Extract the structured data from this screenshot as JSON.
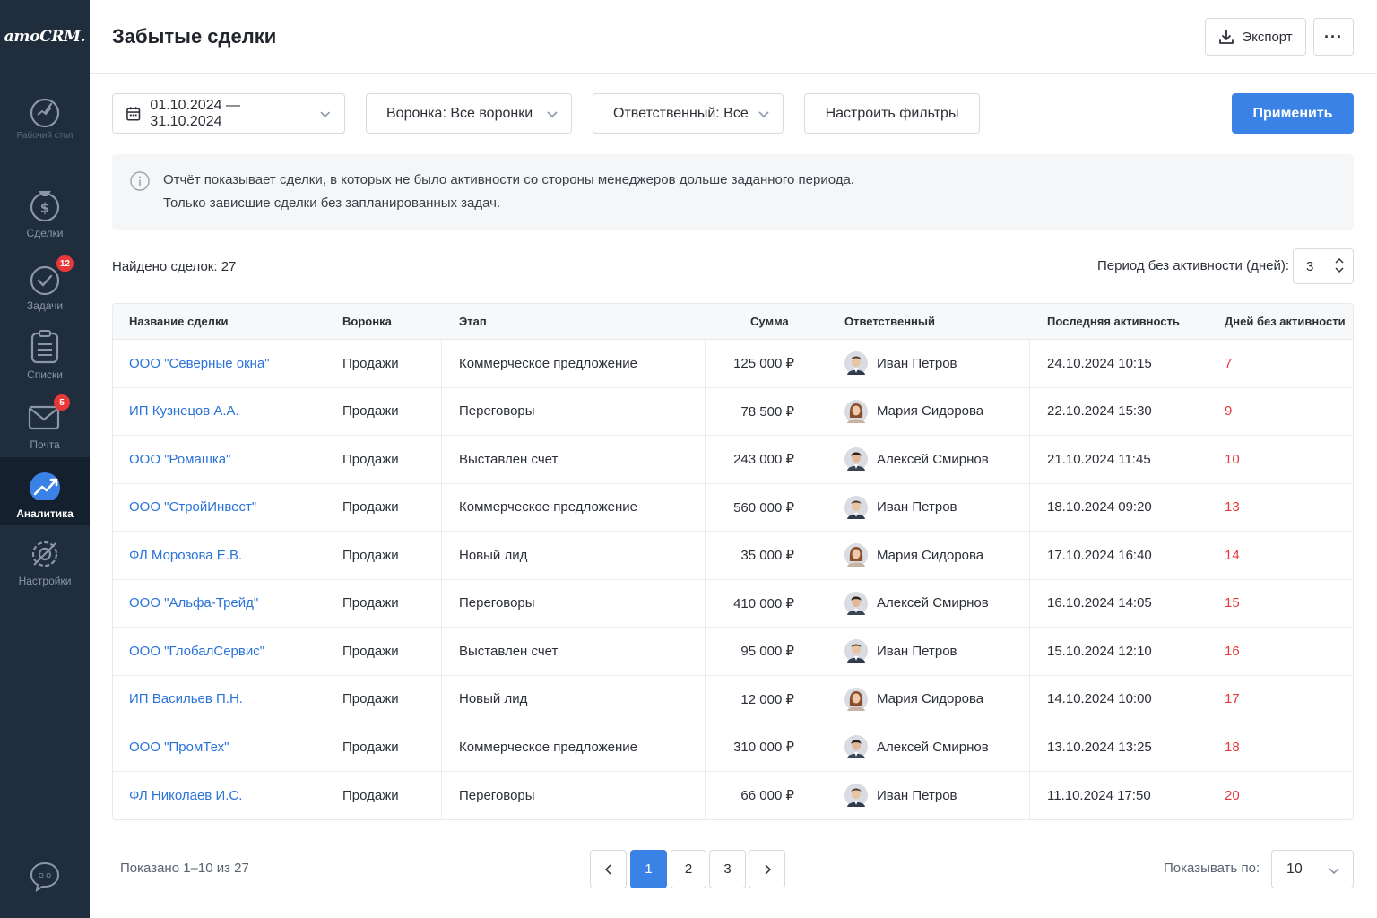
{
  "app": {
    "logo": "amoCRM."
  },
  "sidebar": {
    "items": [
      {
        "label": "",
        "sublabel": "Рабочий стол",
        "icon": "dashboard-icon"
      },
      {
        "label": "Сделки",
        "icon": "deals-icon"
      },
      {
        "label": "Задачи",
        "icon": "tasks-icon",
        "badge": "12"
      },
      {
        "label": "Списки",
        "icon": "lists-icon"
      },
      {
        "label": "Почта",
        "icon": "mail-icon",
        "badge": "5"
      },
      {
        "label": "Аналитика",
        "icon": "analytics-icon",
        "active": true
      },
      {
        "label": "Настройки",
        "icon": "settings-icon"
      }
    ],
    "chat_icon": "chat-icon"
  },
  "header": {
    "title": "Забытые сделки",
    "export_label": "Экспорт",
    "more_label": "···"
  },
  "filters": {
    "date_range": "01.10.2024 — 31.10.2024",
    "pipeline": "Воронка: Все воронки",
    "responsible": "Ответственный: Все",
    "configure": "Настроить фильтры",
    "apply": "Применить"
  },
  "info": {
    "line1": "Отчёт показывает сделки, в которых не было активности со стороны менеджеров дольше заданного периода.",
    "line2": "Только зависшие сделки без запланированных задач."
  },
  "summary": {
    "found": "Найдено сделок: 27",
    "period_label": "Период без активности (дней):",
    "period_value": "3"
  },
  "table": {
    "columns": [
      "Название сделки",
      "Воронка",
      "Этап",
      "Сумма",
      "Ответственный",
      "Последняя активность",
      "Дней без активности"
    ],
    "rows": [
      {
        "name": "ООО \"Северные окна\"",
        "pipeline": "Продажи",
        "stage": "Коммерческое предложение",
        "sum": "125 000 ₽",
        "owner": "Иван Петров",
        "avatar": "m1",
        "last": "24.10.2024 10:15",
        "days": "7"
      },
      {
        "name": "ИП Кузнецов А.А.",
        "pipeline": "Продажи",
        "stage": "Переговоры",
        "sum": "78 500 ₽",
        "owner": "Мария Сидорова",
        "avatar": "f",
        "last": "22.10.2024 15:30",
        "days": "9"
      },
      {
        "name": "ООО \"Ромашка\"",
        "pipeline": "Продажи",
        "stage": "Выставлен счет",
        "sum": "243 000 ₽",
        "owner": "Алексей Смирнов",
        "avatar": "m2",
        "last": "21.10.2024 11:45",
        "days": "10"
      },
      {
        "name": "ООО \"СтройИнвест\"",
        "pipeline": "Продажи",
        "stage": "Коммерческое предложение",
        "sum": "560 000 ₽",
        "owner": "Иван Петров",
        "avatar": "m1",
        "last": "18.10.2024 09:20",
        "days": "13"
      },
      {
        "name": "ФЛ Морозова Е.В.",
        "pipeline": "Продажи",
        "stage": "Новый лид",
        "sum": "35 000 ₽",
        "owner": "Мария Сидорова",
        "avatar": "f",
        "last": "17.10.2024 16:40",
        "days": "14"
      },
      {
        "name": "ООО \"Альфа-Трейд\"",
        "pipeline": "Продажи",
        "stage": "Переговоры",
        "sum": "410 000 ₽",
        "owner": "Алексей Смирнов",
        "avatar": "m2",
        "last": "16.10.2024 14:05",
        "days": "15"
      },
      {
        "name": "ООО \"ГлобалСервис\"",
        "pipeline": "Продажи",
        "stage": "Выставлен счет",
        "sum": "95 000 ₽",
        "owner": "Иван Петров",
        "avatar": "m1",
        "last": "15.10.2024 12:10",
        "days": "16"
      },
      {
        "name": "ИП Васильев П.Н.",
        "pipeline": "Продажи",
        "stage": "Новый лид",
        "sum": "12 000 ₽",
        "owner": "Мария Сидорова",
        "avatar": "f",
        "last": "14.10.2024 10:00",
        "days": "17"
      },
      {
        "name": "ООО \"ПромТех\"",
        "pipeline": "Продажи",
        "stage": "Коммерческое предложение",
        "sum": "310 000 ₽",
        "owner": "Алексей Смирнов",
        "avatar": "m2",
        "last": "13.10.2024 13:25",
        "days": "18"
      },
      {
        "name": "ФЛ Николаев И.С.",
        "pipeline": "Продажи",
        "stage": "Переговоры",
        "sum": "66 000 ₽",
        "owner": "Иван Петров",
        "avatar": "m1",
        "last": "11.10.2024 17:50",
        "days": "20"
      }
    ]
  },
  "pagination": {
    "shown": "Показано 1–10 из 27",
    "pages": [
      "1",
      "2",
      "3"
    ],
    "current": "1",
    "per_page_label": "Показывать по:",
    "per_page_value": "10"
  },
  "colors": {
    "sidebar": "#1f2d3d",
    "accent": "#3b82e6",
    "link": "#2a73d8",
    "overdue": "#e43a3a",
    "badge": "#e9383a"
  }
}
